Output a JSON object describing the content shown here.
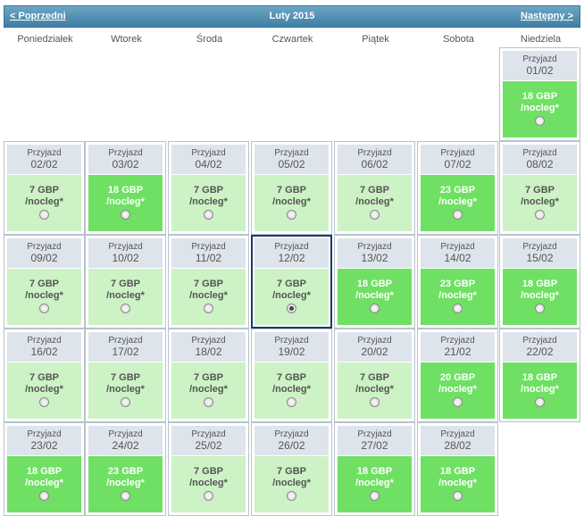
{
  "header": {
    "prev_label": "< Poprzedni",
    "title": "Luty 2015",
    "next_label": "Następny >"
  },
  "weekdays": [
    "Poniedziałek",
    "Wtorek",
    "Środa",
    "Czwartek",
    "Piątek",
    "Sobota",
    "Niedziela"
  ],
  "arrival_label": "Przyjazd",
  "per_night_label": "/nocleg*",
  "colors": {
    "light": "#cdf2c5",
    "dark": "#6fe064",
    "header": "#4b8ab0"
  },
  "days": [
    {
      "date": "01/02",
      "price": "18 GBP",
      "style": "dark",
      "selected": false
    },
    {
      "date": "02/02",
      "price": "7 GBP",
      "style": "light",
      "selected": false
    },
    {
      "date": "03/02",
      "price": "18 GBP",
      "style": "dark",
      "selected": false
    },
    {
      "date": "04/02",
      "price": "7 GBP",
      "style": "light",
      "selected": false
    },
    {
      "date": "05/02",
      "price": "7 GBP",
      "style": "light",
      "selected": false
    },
    {
      "date": "06/02",
      "price": "7 GBP",
      "style": "light",
      "selected": false
    },
    {
      "date": "07/02",
      "price": "23 GBP",
      "style": "dark",
      "selected": false
    },
    {
      "date": "08/02",
      "price": "7 GBP",
      "style": "light",
      "selected": false
    },
    {
      "date": "09/02",
      "price": "7 GBP",
      "style": "light",
      "selected": false
    },
    {
      "date": "10/02",
      "price": "7 GBP",
      "style": "light",
      "selected": false
    },
    {
      "date": "11/02",
      "price": "7 GBP",
      "style": "light",
      "selected": false
    },
    {
      "date": "12/02",
      "price": "7 GBP",
      "style": "light",
      "selected": true
    },
    {
      "date": "13/02",
      "price": "18 GBP",
      "style": "dark",
      "selected": false
    },
    {
      "date": "14/02",
      "price": "23 GBP",
      "style": "dark",
      "selected": false
    },
    {
      "date": "15/02",
      "price": "18 GBP",
      "style": "dark",
      "selected": false
    },
    {
      "date": "16/02",
      "price": "7 GBP",
      "style": "light",
      "selected": false
    },
    {
      "date": "17/02",
      "price": "7 GBP",
      "style": "light",
      "selected": false
    },
    {
      "date": "18/02",
      "price": "7 GBP",
      "style": "light",
      "selected": false
    },
    {
      "date": "19/02",
      "price": "7 GBP",
      "style": "light",
      "selected": false
    },
    {
      "date": "20/02",
      "price": "7 GBP",
      "style": "light",
      "selected": false
    },
    {
      "date": "21/02",
      "price": "20 GBP",
      "style": "dark",
      "selected": false
    },
    {
      "date": "22/02",
      "price": "18 GBP",
      "style": "dark",
      "selected": false
    },
    {
      "date": "23/02",
      "price": "18 GBP",
      "style": "dark",
      "selected": false
    },
    {
      "date": "24/02",
      "price": "23 GBP",
      "style": "dark",
      "selected": false
    },
    {
      "date": "25/02",
      "price": "7 GBP",
      "style": "light",
      "selected": false
    },
    {
      "date": "26/02",
      "price": "7 GBP",
      "style": "light",
      "selected": false
    },
    {
      "date": "27/02",
      "price": "18 GBP",
      "style": "dark",
      "selected": false
    },
    {
      "date": "28/02",
      "price": "18 GBP",
      "style": "dark",
      "selected": false
    }
  ]
}
